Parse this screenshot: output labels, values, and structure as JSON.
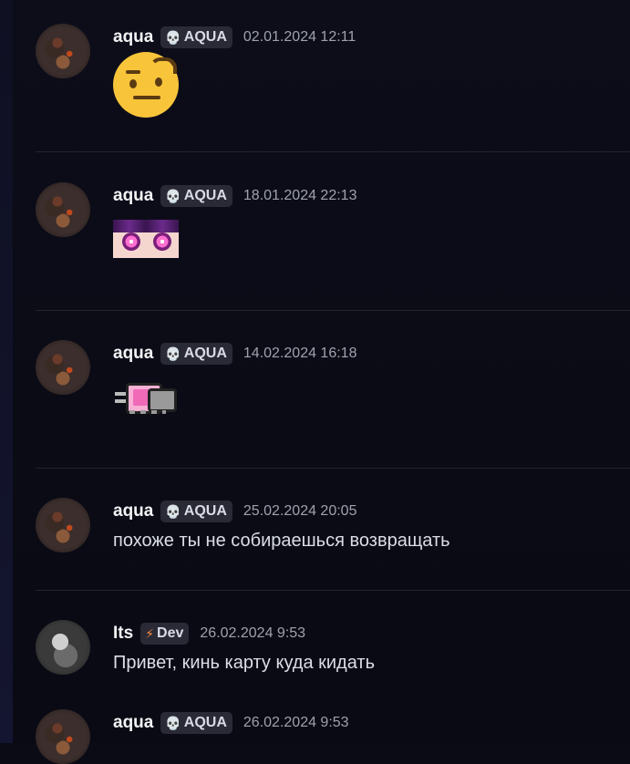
{
  "messages": [
    {
      "author": "aqua",
      "tag": "AQUA",
      "tag_icon": "skull-icon",
      "timestamp": "02.01.2024 12:11",
      "emoji": "thinking-face-emoji"
    },
    {
      "author": "aqua",
      "tag": "AQUA",
      "tag_icon": "skull-icon",
      "timestamp": "18.01.2024 22:13",
      "emoji": "anime-eyes-emoji"
    },
    {
      "author": "aqua",
      "tag": "AQUA",
      "tag_icon": "skull-icon",
      "timestamp": "14.02.2024 16:18",
      "emoji": "nyan-cat-emoji"
    },
    {
      "author": "aqua",
      "tag": "AQUA",
      "tag_icon": "skull-icon",
      "timestamp": "25.02.2024 20:05",
      "text": "похоже ты не собираешься возвращать"
    },
    {
      "author": "Its",
      "tag": "Dev",
      "tag_icon": "lightning-icon",
      "timestamp": "26.02.2024 9:53",
      "text": "Привет, кинь карту куда кидать"
    },
    {
      "author": "aqua",
      "tag": "AQUA",
      "tag_icon": "skull-icon",
      "timestamp": "26.02.2024 9:53"
    }
  ],
  "colors": {
    "background": "#0b0b16",
    "username": "#f2f3f5",
    "timestamp": "#9ea2ad",
    "tag_background": "#2a2a36",
    "aqua_tag_icon": "#c9a7ff",
    "dev_tag_icon": "#ff8a3d"
  }
}
